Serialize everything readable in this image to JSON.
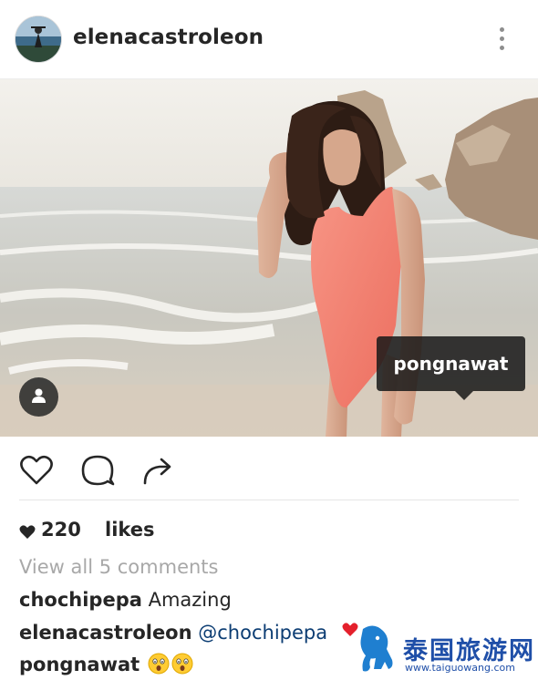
{
  "post": {
    "username": "elenacastroleon",
    "avatar_icon": "profile-avatar",
    "more_icon": "more-vertical-icon",
    "photo_tag": "pongnawat",
    "user_tag_icon": "person-icon"
  },
  "actions": {
    "like_icon": "heart-outline-icon",
    "comment_icon": "comment-bubble-icon",
    "share_icon": "share-arrow-icon"
  },
  "likes": {
    "count": "220",
    "label": "likes",
    "icon": "heart-filled-icon"
  },
  "view_all_comments": "View all 5 comments",
  "comments": [
    {
      "author": "chochipepa",
      "text": "Amazing"
    },
    {
      "author": "elenacastroleon",
      "mention": "@chochipepa"
    },
    {
      "author": "pongnawat",
      "emojis": [
        "astonished-emoji",
        "astonished-emoji"
      ]
    }
  ],
  "watermark": {
    "name": "泰国旅游网",
    "url": "www.taiguowang.com",
    "color": "#1f4fa8",
    "accent": "#e4202c"
  },
  "colors": {
    "text": "#262626",
    "muted": "#a8a8a8",
    "mention": "#0c3d73",
    "swimsuit": "#f47f6f"
  }
}
